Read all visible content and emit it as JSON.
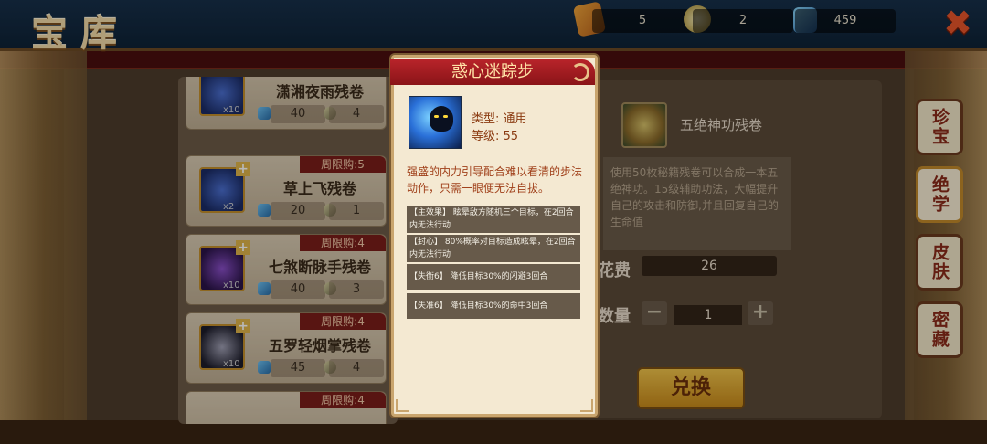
{
  "screen_title": "宝库",
  "currencies": [
    {
      "icon": "scroll-icon",
      "value": "5"
    },
    {
      "icon": "ball-icon",
      "value": "2"
    },
    {
      "icon": "gem-icon",
      "value": "459"
    }
  ],
  "close_label": "✖",
  "list": {
    "items": [
      {
        "name": "潇湘夜雨残卷",
        "limit": "",
        "count": "x10",
        "gem_cost": "40",
        "stone_cost": "4"
      },
      {
        "name": "草上飞残卷",
        "limit": "周限购:5",
        "count": "x2",
        "gem_cost": "20",
        "stone_cost": "1"
      },
      {
        "name": "七煞断脉手残卷",
        "limit": "周限购:4",
        "count": "x10",
        "gem_cost": "40",
        "stone_cost": "3"
      },
      {
        "name": "五罗轻烟掌残卷",
        "limit": "周限购:4",
        "count": "x10",
        "gem_cost": "45",
        "stone_cost": "4"
      },
      {
        "name": "",
        "limit": "周限购:4",
        "count": "",
        "gem_cost": "",
        "stone_cost": ""
      }
    ]
  },
  "detail": {
    "name": "五绝神功残卷",
    "description": "使用50枚秘籍残卷可以合成一本五绝神功。15级辅助功法，大幅提升自己的攻击和防御,并且回复自己的生命值",
    "cost_label": "花费",
    "cost_value": "26",
    "qty_label": "数量",
    "qty_value": "1",
    "minus": "−",
    "plus": "+",
    "exchange_label": "兑换"
  },
  "tabs": [
    "珍宝",
    "绝学",
    "皮肤",
    "密藏"
  ],
  "popup": {
    "title": "惑心迷踪步",
    "type_text": "类型: 通用",
    "level_text": "等级: 55",
    "description": "强盛的内力引导配合难以看清的步法动作，只需一眼便无法自拔。",
    "effects": [
      "【主效果】 眩晕敌方随机三个目标，在2回合内无法行动",
      "【封心】 80%概率对目标造成眩晕，在2回合内无法行动",
      "【失衡6】 降低目标30%的闪避3回合",
      "【失准6】 降低目标30%的命中3回合"
    ]
  },
  "colors": {
    "popup_header": "#b8242a",
    "popup_bg": "#f4e9d2",
    "limit_tag": "#7a1e1a",
    "exchange_button": "#f0c34a"
  }
}
